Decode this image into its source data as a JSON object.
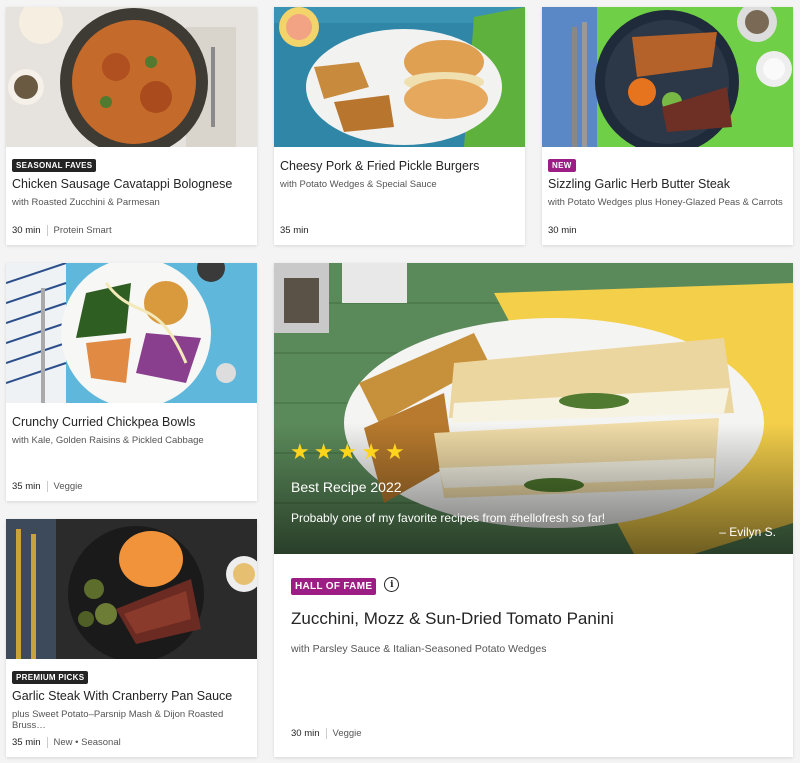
{
  "colors": {
    "accent_purple": "#9c1d84",
    "badge_dark": "#242424",
    "star_yellow": "#ffd41c"
  },
  "recipes": [
    {
      "badge": "SEASONAL FAVES",
      "title": "Chicken Sausage Cavatappi Bolognese",
      "subtitle": "with Roasted Zucchini & Parmesan",
      "time": "30 min",
      "tag": "Protein Smart"
    },
    {
      "badge": "",
      "title": "Cheesy Pork & Fried Pickle Burgers",
      "subtitle": "with Potato Wedges & Special Sauce",
      "time": "35 min",
      "tag": ""
    },
    {
      "badge": "NEW",
      "title": "Sizzling Garlic Herb Butter Steak",
      "subtitle": "with Potato Wedges plus Honey-Glazed Peas & Carrots",
      "time": "30 min",
      "tag": ""
    },
    {
      "badge": "",
      "title": "Crunchy Curried Chickpea Bowls",
      "subtitle": "with Kale, Golden Raisins & Pickled Cabbage",
      "time": "35 min",
      "tag": "Veggie"
    },
    {
      "badge": "PREMIUM PICKS",
      "title": "Garlic Steak With Cranberry Pan Sauce",
      "subtitle": "plus Sweet Potato–Parsnip Mash & Dijon Roasted Bruss…",
      "time": "35 min",
      "tag": "New • Seasonal"
    }
  ],
  "feature": {
    "rating": 5,
    "stars": [
      "★",
      "★",
      "★",
      "★",
      "★"
    ],
    "award": "Best Recipe 2022",
    "quote": "Probably one of my favorite recipes from #hellofresh so far!",
    "author": "– Evilyn S.",
    "badge": "HALL OF FAME",
    "info_glyph": "i",
    "title": "Zucchini, Mozz & Sun-Dried Tomato Panini",
    "subtitle": "with Parsley Sauce & Italian-Seasoned Potato Wedges",
    "time": "30 min",
    "tag": "Veggie"
  }
}
